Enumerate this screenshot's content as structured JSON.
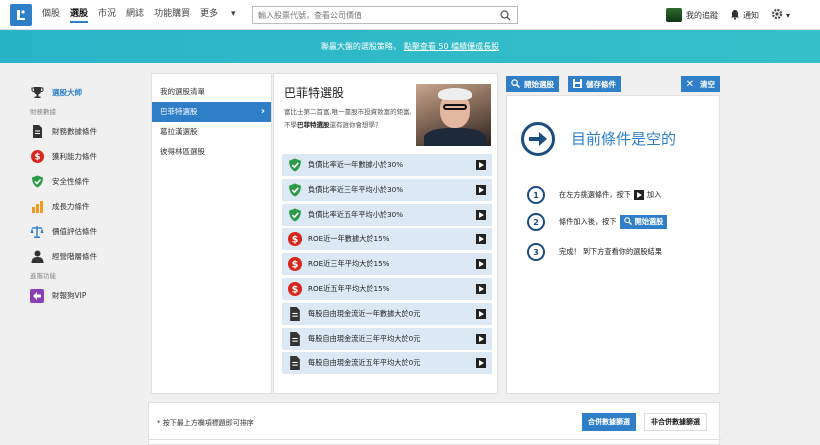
{
  "nav": {
    "items": [
      "個股",
      "選股",
      "市況",
      "網誌",
      "功能購買",
      "更多"
    ],
    "active_index": 1,
    "more_caret": "▾"
  },
  "search": {
    "placeholder": "輸入股票代號，查看公司價值"
  },
  "user_nav": {
    "tracking": "我的追蹤",
    "notify": "通知",
    "gear_caret": "▾"
  },
  "banner": {
    "text": "聯贏大盤的選股策略，",
    "link": "點擊查看 50 檔績優成長股"
  },
  "sidebar": {
    "top": "選股大師",
    "sections": [
      {
        "title": "財務數據",
        "items": [
          "財務數據條件",
          "獲利能力條件",
          "安全性條件",
          "成長力條件",
          "價值評估條件",
          "經營階層條件"
        ]
      },
      {
        "title": "進階功能",
        "items": [
          "財報狗VIP"
        ]
      }
    ]
  },
  "lists": [
    "我的選股清單",
    "巴菲特選股",
    "葛拉漢選股",
    "彼得林區選股"
  ],
  "lists_selected": 1,
  "strategy": {
    "title": "巴菲特選股",
    "desc_1": "富比士第二首富,唯一靠股市投資致富的鉅富,不學",
    "desc_bold": "巴菲特選股",
    "desc_2": "還有誰你會想學？",
    "conditions": [
      {
        "icon": "shield",
        "text": "負債比率近一年數據小於30%"
      },
      {
        "icon": "shield",
        "text": "負債比率近三年平均小於30%"
      },
      {
        "icon": "shield",
        "text": "負債比率近五年平均小於30%"
      },
      {
        "icon": "dollar",
        "text": "ROE近一年數據大於15%"
      },
      {
        "icon": "dollar",
        "text": "ROE近三年平均大於15%"
      },
      {
        "icon": "dollar",
        "text": "ROE近五年平均大於15%"
      },
      {
        "icon": "doc",
        "text": "每股自由現金流近一年數據大於0元"
      },
      {
        "icon": "doc",
        "text": "每股自由現金流近三年平均大於0元"
      },
      {
        "icon": "doc",
        "text": "每股自由現金流近五年平均大於0元"
      }
    ]
  },
  "toolbar": {
    "start": "開始選股",
    "save": "儲存條件",
    "clear": "清空"
  },
  "empty": {
    "title": "目前條件是空的",
    "step1_a": "在左方挑選條件，按下",
    "step1_b": "加入",
    "step2_a": "條件加入後，按下",
    "step2_btn": "開始選股",
    "step3": "完成！ 到下方查看你的選股結果",
    "nums": [
      "1",
      "2",
      "3"
    ]
  },
  "bottom": {
    "hint": "* 按下最上方欄項標題即可排序",
    "merged": "合併數據篩選",
    "unmerged": "非合併數據篩選"
  }
}
